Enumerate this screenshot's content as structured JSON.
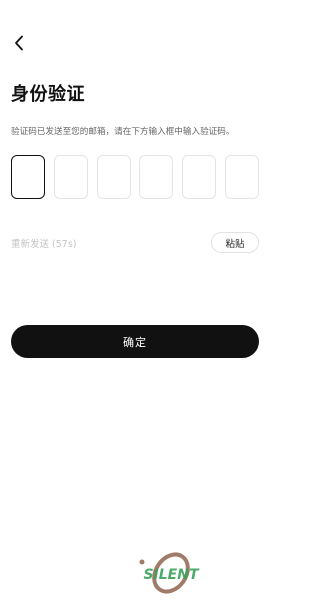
{
  "header": {
    "back_icon": "chevron-left-icon",
    "title": "身份验证"
  },
  "instruction": "验证码已发送至您的邮箱，请在下方输入框中输入验证码。",
  "code_inputs": {
    "count": 6,
    "values": [
      "",
      "",
      "",
      "",
      "",
      ""
    ],
    "active_index": 0
  },
  "resend": {
    "label": "重新发送 (57s)"
  },
  "paste_button": {
    "label": "粘贴"
  },
  "confirm_button": {
    "label": "确定"
  },
  "watermark": {
    "text": "SILENT",
    "icon": "silent-logo-watermark"
  },
  "colors": {
    "primary": "#111111",
    "muted_text": "#666666",
    "disabled_text": "#c4c4c4",
    "border": "#e4e4e4",
    "watermark_green": "#3aa15a",
    "watermark_brown": "#8a5a44"
  }
}
